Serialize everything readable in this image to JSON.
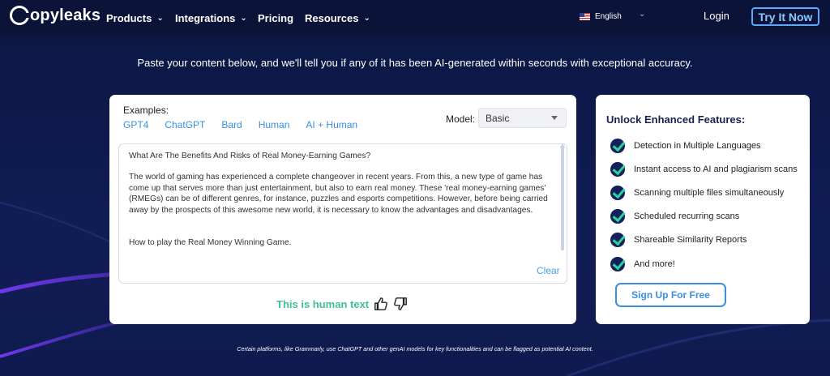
{
  "colors": {
    "nav_bg": "#0b1438",
    "page_bg": "#0e1a4a",
    "accent_blue": "#3b8fdf",
    "accent_green": "#3fbf9a",
    "check_green": "#2fd19a"
  },
  "nav": {
    "logo_text": "opyleaks",
    "menu": [
      "Products",
      "Integrations",
      "Pricing",
      "Resources"
    ],
    "language": "English",
    "login": "Login",
    "try_button": "Try It Now"
  },
  "headline": "Paste your content below, and we'll tell you if any of it has been AI-generated within seconds with exceptional accuracy.",
  "detector": {
    "examples_label": "Examples:",
    "examples": [
      "GPT4",
      "ChatGPT",
      "Bard",
      "Human",
      "AI + Human"
    ],
    "model_label": "Model:",
    "model_value": "Basic",
    "text_title": "What Are The Benefits And Risks of Real Money-Earning Games?",
    "text_paragraph": "The world of gaming has experienced a complete changeover in recent years. From this, a new type of game has come up that serves more than just entertainment, but also to earn real money. These 'real money-earning games' (RMEGs) can be of different genres, for instance, puzzles and esports competitions. However, before being carried away by the prospects of this awesome new world, it is necessary to know the advantages and disadvantages.",
    "text_line": "How to play the Real Money Winning Game.",
    "clear": "Clear",
    "result": "This is human text"
  },
  "side": {
    "title": "Unlock Enhanced Features:",
    "features": [
      "Detection in Multiple Languages",
      "Instant access to AI and plagiarism scans",
      "Scanning multiple files simultaneously",
      "Scheduled recurring scans",
      "Shareable Similarity Reports",
      "And more!"
    ],
    "signup": "Sign Up For Free"
  },
  "footnote": "Certain platforms, like Grammarly, use ChatGPT and other genAI models for key functionalities and can be flagged as potential AI content."
}
